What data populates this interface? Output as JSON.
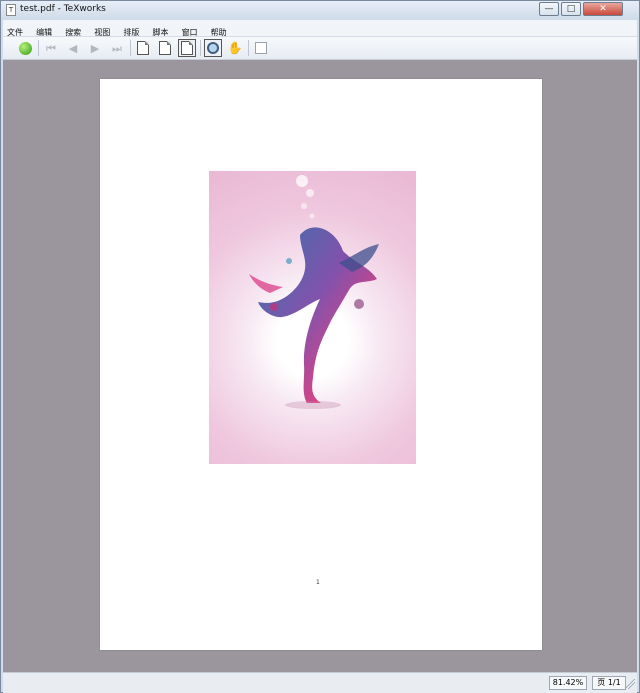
{
  "window": {
    "title": "test.pdf - TeXworks",
    "controls": {
      "minimize": "—",
      "maximize": "□",
      "close": "✕"
    }
  },
  "menu": [
    "文件",
    "编辑",
    "搜索",
    "视图",
    "排版",
    "脚本",
    "窗口",
    "帮助"
  ],
  "toolbar": {
    "buttons": [
      "typeset-icon",
      "first-page-icon",
      "previous-page-icon",
      "next-page-icon",
      "last-page-icon",
      "actual-size-icon",
      "fit-width-icon",
      "fit-page-icon",
      "magnifier-icon",
      "hand-tool-icon",
      "zoom-small-icon"
    ]
  },
  "document": {
    "page_number": "1"
  },
  "statusbar": {
    "zoom": "81.42%",
    "page": "页 1/1"
  }
}
